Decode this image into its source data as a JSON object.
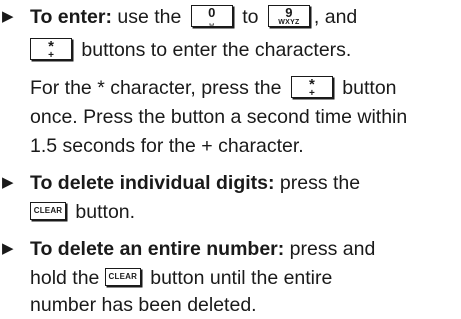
{
  "bullet_glyph": "▶",
  "keys": {
    "zero": {
      "main": "0",
      "sub": "␣"
    },
    "nine": {
      "main": "9",
      "sub": "WXYZ"
    },
    "star": {
      "main": "*",
      "sub": "+"
    },
    "clear": {
      "label": "CLEAR"
    }
  },
  "items": {
    "enter": {
      "label": "To enter:",
      "line1_a": " use the ",
      "line1_b": " to ",
      "line1_c": ", and",
      "line2": " buttons to enter the characters.",
      "note_line1_a": "For the * character, press the ",
      "note_line1_b": " button",
      "note_line2": "once. Press the button a second time within",
      "note_line3": "1.5 seconds for the + character."
    },
    "delete_digits": {
      "label": "To delete individual digits:",
      "line1_rest": " press the",
      "line2": " button."
    },
    "delete_number": {
      "label": "To delete an entire number:",
      "line1_rest": " press and",
      "line2_a": "hold the ",
      "line2_b": " button until the entire",
      "line3": "number has been deleted."
    }
  }
}
